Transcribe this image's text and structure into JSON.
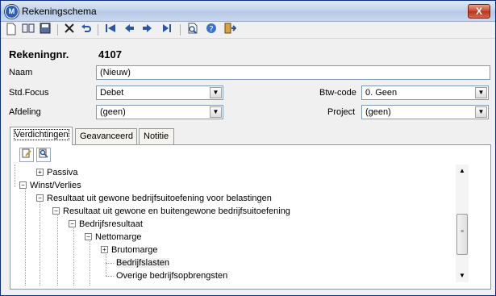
{
  "window": {
    "title": "Rekeningschema",
    "app_icon": "M",
    "close_glyph": "X"
  },
  "toolbar": {
    "icons": [
      "new-document-icon",
      "open-book-icon",
      "save-icon",
      "delete-icon",
      "undo-icon",
      "first-record-icon",
      "previous-record-icon",
      "next-record-icon",
      "last-record-icon",
      "print-preview-icon",
      "help-icon",
      "exit-icon"
    ]
  },
  "account": {
    "label": "Rekeningnr.",
    "number": "4107"
  },
  "form": {
    "naam_label": "Naam",
    "naam_value": "(Nieuw)",
    "stdfocus_label": "Std.Focus",
    "stdfocus_value": "Debet",
    "btwcode_label": "Btw-code",
    "btwcode_value": "0. Geen",
    "afdeling_label": "Afdeling",
    "afdeling_value": "(geen)",
    "project_label": "Project",
    "project_value": "(geen)"
  },
  "tabs": [
    "Verdichtingen",
    "Geavanceerd",
    "Notitie"
  ],
  "tree": {
    "nodes": [
      {
        "label": "Passiva",
        "expander": "+",
        "selected": false
      },
      {
        "label": "Winst/Verlies",
        "expander": "−",
        "selected": false
      },
      {
        "label": "Resultaat uit gewone bedrijfsuitoefening voor belastingen",
        "expander": "−",
        "selected": false
      },
      {
        "label": "Resultaat uit gewone en buitengewone bedrijfsuitoefening",
        "expander": "−",
        "selected": false
      },
      {
        "label": "Bedrijfsresultaat",
        "expander": "−",
        "selected": false
      },
      {
        "label": "Nettomarge",
        "expander": "−",
        "selected": false
      },
      {
        "label": "Brutomarge",
        "expander": "+",
        "selected": false
      },
      {
        "label": "Bedrijfslasten",
        "expander": "",
        "selected": true
      },
      {
        "label": "Overige bedrijfsopbrengsten",
        "expander": "",
        "selected": false
      }
    ]
  },
  "scrollbar": {
    "up": "▲",
    "down": "▼",
    "grip": "≡"
  },
  "combo_arrow": "▼",
  "colors": {
    "titlebar": "#c3d3ea",
    "close": "#c8452c",
    "border": "#7f9db9"
  }
}
